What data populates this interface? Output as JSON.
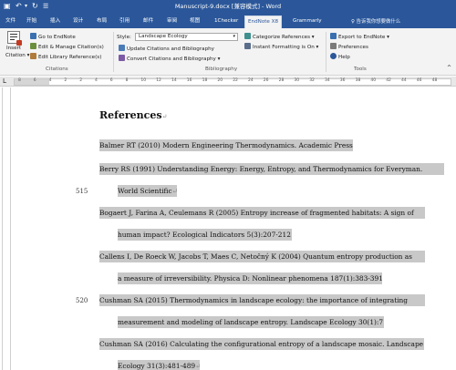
{
  "titlebar": {
    "title": "Manuscript-9.docx [兼容模式] - Word",
    "save_icon": "save-icon",
    "undo_icon": "undo-icon",
    "redo_icon": "redo-icon",
    "customize_icon": "customize-icon"
  },
  "tabs": [
    {
      "label": "文件"
    },
    {
      "label": "开始"
    },
    {
      "label": "插入"
    },
    {
      "label": "设计"
    },
    {
      "label": "布局"
    },
    {
      "label": "引用"
    },
    {
      "label": "邮件"
    },
    {
      "label": "审阅"
    },
    {
      "label": "视图"
    },
    {
      "label": "1Checker"
    },
    {
      "label": "EndNote X8"
    },
    {
      "label": "Grammarly"
    }
  ],
  "tell_me": "♀ 告诉我你想要做什么",
  "ribbon": {
    "citations": {
      "insert_citation_line1": "Insert",
      "insert_citation_line2": "Citation ▾",
      "go_to_endnote": "Go to EndNote",
      "edit_manage": "Edit & Manage Citation(s)",
      "edit_library": "Edit Library Reference(s)",
      "group_label": "Citations"
    },
    "bibliography": {
      "style_label": "Style:",
      "style_value": "Landscape Ecology",
      "update": "Update Citations and Bibliography",
      "convert": "Convert Citations and Bibliography ▾",
      "categorize": "Categorize References ▾",
      "instant_formatting": "Instant Formatting is On ▾",
      "group_label": "Bibliography"
    },
    "tools": {
      "export": "Export to EndNote ▾",
      "preferences": "Preferences",
      "help": "Help",
      "group_label": "Tools"
    }
  },
  "ruler_numbers": [
    "8",
    "6",
    "4",
    "2",
    "2",
    "4",
    "6",
    "8",
    "10",
    "12",
    "14",
    "16",
    "18",
    "20",
    "22",
    "24",
    "26",
    "28",
    "30",
    "32",
    "34",
    "36",
    "38",
    "40",
    "42",
    "44",
    "46",
    "48"
  ],
  "document": {
    "heading": "References",
    "lines": [
      {
        "text": "Balmer RT (2010) Modern Engineering Thermodynamics. Academic Press"
      },
      {
        "text": "Berry RS (1991) Understanding Energy: Energy, Entropy, and Thermodynamics for Everyman."
      },
      {
        "text": "World Scientific"
      },
      {
        "text": "Bogaert J, Farina A, Ceulemans R (2005) Entropy increase of fragmented habitats: A sign of"
      },
      {
        "text": "human impact? Ecological Indicators 5(3):207-212"
      },
      {
        "text": "Callens I, De Roeck W, Jacobs T, Maes C, Netočný K (2004) Quantum entropy production as"
      },
      {
        "text": "a measure of irreversibility. Physica D: Nonlinear phenomena 187(1):383-391"
      },
      {
        "text": "Cushman SA (2015) Thermodynamics in landscape ecology: the importance of integrating"
      },
      {
        "text": "measurement and modeling of landscape entropy. Landscape Ecology 30(1):7"
      },
      {
        "text": "Cushman SA (2016) Calculating the configurational entropy of a landscape mosaic. Landscape"
      },
      {
        "text": "Ecology 31(3):481-489"
      }
    ],
    "line_numbers": {
      "first": "515",
      "second": "520"
    }
  }
}
